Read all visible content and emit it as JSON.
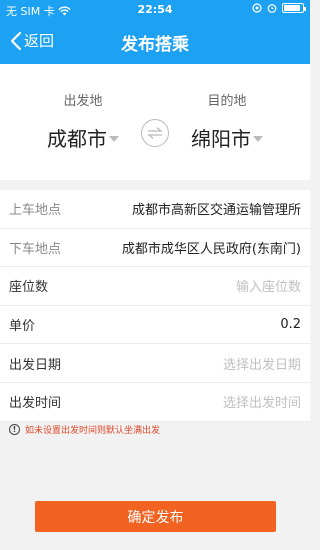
{
  "status_bar": {
    "carrier": "无 SIM 卡",
    "time": "22:54"
  },
  "nav": {
    "back_label": "返回",
    "title": "发布搭乘"
  },
  "route": {
    "from_label": "出发地",
    "from_city": "成都市",
    "to_label": "目的地",
    "to_city": "绵阳市"
  },
  "form": {
    "pickup": {
      "label": "上车地点",
      "value": "成都市高新区交通运输管理所"
    },
    "dropoff": {
      "label": "下车地点",
      "value": "成都市成华区人民政府(东南门)"
    },
    "seats": {
      "label": "座位数",
      "placeholder": "输入座位数"
    },
    "price": {
      "label": "单价",
      "value": "0.2"
    },
    "date": {
      "label": "出发日期",
      "placeholder": "选择出发日期"
    },
    "time": {
      "label": "出发时间",
      "placeholder": "选择出发时间"
    }
  },
  "notice": "如未设置出发时间则默认坐满出发",
  "submit_label": "确定发布",
  "colors": {
    "primary": "#1da1f2",
    "accent": "#f26322",
    "warning_text": "#e04a2b"
  }
}
